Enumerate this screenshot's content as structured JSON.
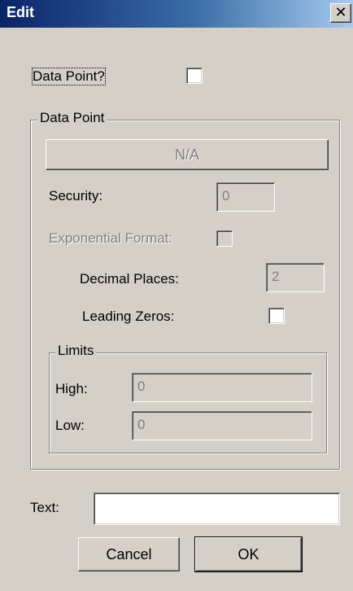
{
  "window": {
    "title": "Edit",
    "close_glyph": "✕"
  },
  "data_point_toggle": {
    "label": "Data Point?",
    "checked": false
  },
  "data_point_group": {
    "title": "Data Point",
    "na_button": "N/A",
    "security": {
      "label": "Security:",
      "value": "0"
    },
    "exponential_format": {
      "label": "Exponential Format:",
      "checked": false
    },
    "decimal_places": {
      "label": "Decimal Places:",
      "value": "2"
    },
    "leading_zeros": {
      "label": "Leading Zeros:",
      "checked": false
    },
    "limits": {
      "title": "Limits",
      "high": {
        "label": "High:",
        "value": "0"
      },
      "low": {
        "label": "Low:",
        "value": "0"
      }
    }
  },
  "text_field": {
    "label": "Text:",
    "value": ""
  },
  "buttons": {
    "cancel": "Cancel",
    "ok": "OK"
  }
}
